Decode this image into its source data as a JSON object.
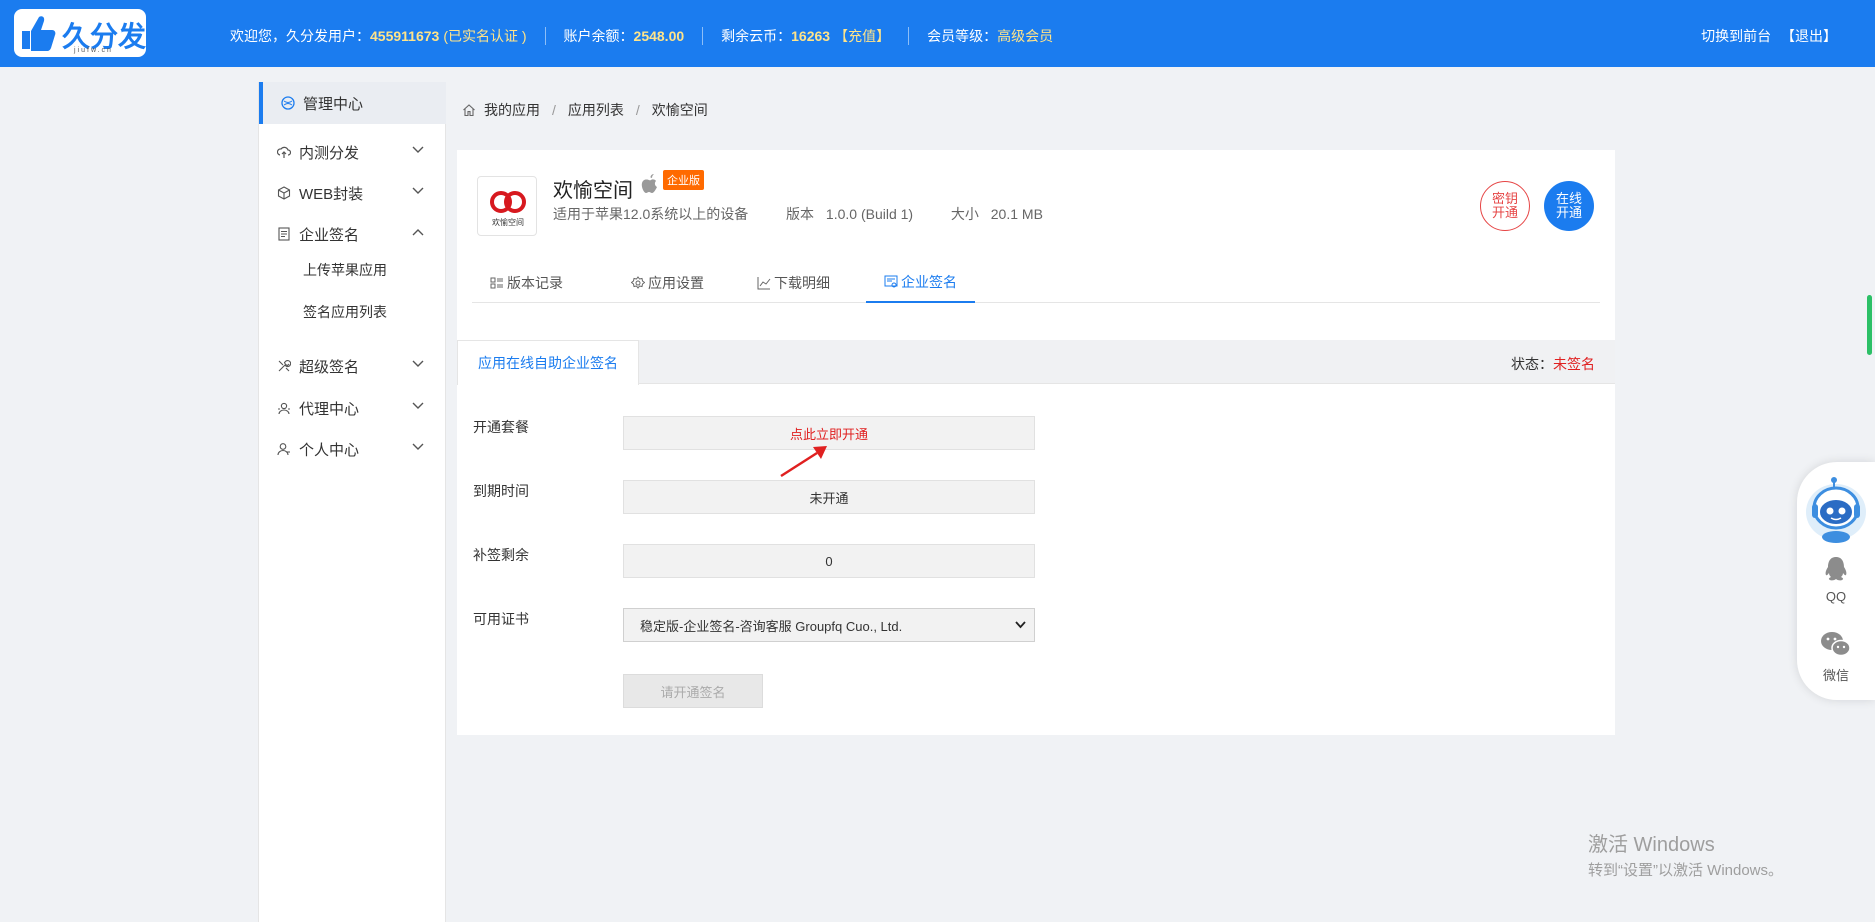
{
  "header": {
    "logo_text": "久分发",
    "logo_url": "jiufw.cn",
    "welcome_prefix": "欢迎您，久分发用户：",
    "user_id": "455911673",
    "verify_status": "(已实名认证 )",
    "balance_label": "账户余额：",
    "balance_value": "2548.00",
    "coins_label": "剩余云币：",
    "coins_value": "16263",
    "recharge_label": "【充值】",
    "member_label": "会员等级：",
    "member_value": "高级会员",
    "switch_front": "切换到前台",
    "logout": "【退出】"
  },
  "sidebar": {
    "active": "管理中心",
    "items": [
      {
        "label": "内测分发"
      },
      {
        "label": "WEB封装"
      },
      {
        "label": "企业签名"
      },
      {
        "label": "超级签名"
      },
      {
        "label": "代理中心"
      },
      {
        "label": "个人中心"
      }
    ],
    "sub_items": [
      "上传苹果应用",
      "签名应用列表"
    ]
  },
  "breadcrumb": [
    "我的应用",
    "应用列表",
    "欢愉空间"
  ],
  "app": {
    "name": "欢愉空间",
    "edition_badge": "企业版",
    "icon_caption": "欢愉空间",
    "compat": "适用于苹果12.0系统以上的设备",
    "version_label": "版本",
    "version_value": "1.0.0 (Build 1)",
    "size_label": "大小",
    "size_value": "20.1 MB",
    "btn_key_line1": "密钥",
    "btn_key_line2": "开通",
    "btn_online_line1": "在线",
    "btn_online_line2": "开通"
  },
  "tabs": [
    "版本记录",
    "应用设置",
    "下载明细",
    "企业签名"
  ],
  "panel": {
    "tab_label": "应用在线自助企业签名",
    "status_label": "状态：",
    "status_value": "未签名"
  },
  "form": {
    "package_label": "开通套餐",
    "package_value": "点此立即开通",
    "expire_label": "到期时间",
    "expire_value": "未开通",
    "resign_label": "补签剩余",
    "resign_value": "0",
    "cert_label": "可用证书",
    "cert_value": "稳定版-企业签名-咨询客服 Groupfq Cuo., Ltd.",
    "submit_label": "请开通签名"
  },
  "float_bar": {
    "qq_label": "QQ",
    "wechat_label": "微信"
  },
  "watermark": {
    "line1": "激活 Windows",
    "line2": "转到“设置”以激活 Windows。"
  },
  "colors": {
    "brand": "#1b7cef",
    "danger": "#e02020",
    "badge": "#ff6a00"
  }
}
